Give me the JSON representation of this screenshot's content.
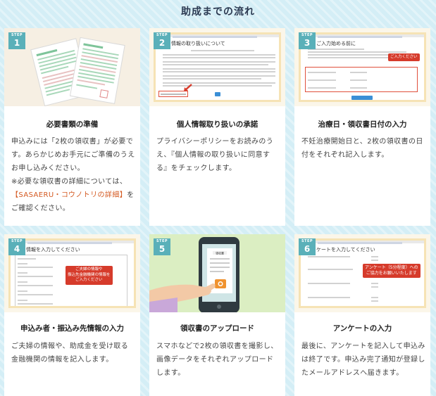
{
  "page": {
    "title": "助成までの流れ"
  },
  "step_label": "STEP",
  "cards": [
    {
      "num": "1",
      "title": "必要書類の準備",
      "desc_a": "申込みには「2枚の領収書」が必要です。あらかじめお手元にご準備のうえお申し込みください。",
      "desc_b": "※必要な領収書の詳細については、",
      "desc_link": "【SASAERU・コウノトリの詳細】",
      "desc_c": "をご確認ください。"
    },
    {
      "num": "2",
      "title": "個人情報取り扱いの承諾",
      "desc": "プライバシーポリシーをお読みのうえ、『個人情報の取り扱いに同意する』をチェックします。",
      "shot_heading": "情報の取り扱いについて"
    },
    {
      "num": "3",
      "title": "治療日・領収書日付の入力",
      "desc": "不妊治療開始日と、2枚の領収書の日付をそれぞれ記入します。",
      "shot_heading": "ご入力始める前に",
      "callout": "ご入力ください"
    },
    {
      "num": "4",
      "title": "申込み者・振込み先情報の入力",
      "desc": "ご夫婦の情報や、助成金を受け取る金融機関の情報を記入します。",
      "shot_heading": "情報を入力してください",
      "callout_1": "ご夫婦の情報や",
      "callout_2": "振込先金融機関の情報を",
      "callout_3": "ご入力ください"
    },
    {
      "num": "5",
      "title": "領収書のアップロード",
      "desc": "スマホなどで2枚の領収書を撮影し、画像データをそれぞれアップロードします。",
      "receipt_label": "領収書"
    },
    {
      "num": "6",
      "title": "アンケートの入力",
      "desc": "最後に、アンケートを記入して申込みは終了です。申込み完了通知が登録したメールアドレスへ届きます。",
      "shot_heading": "ケートを入力してください",
      "callout_1": "アンケート（5分程度）への",
      "callout_2": "ご協力をお願いいたします"
    }
  ],
  "colors": {
    "step_badge": "#5ab0b9",
    "callout_red": "#d63b2b",
    "link_orange": "#d45a22",
    "background": "#d4eef6"
  }
}
